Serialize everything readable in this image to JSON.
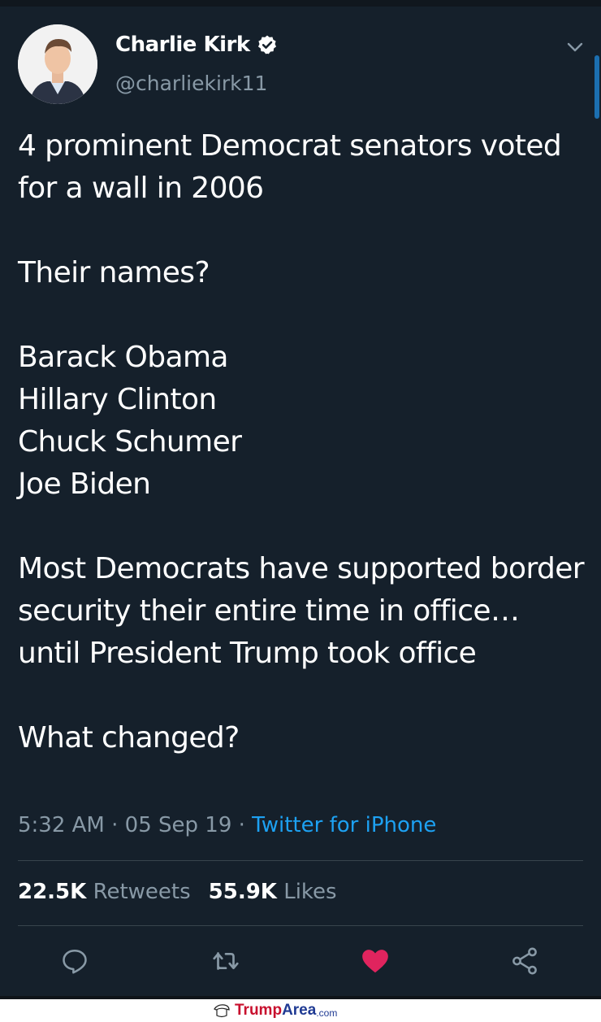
{
  "user": {
    "name": "Charlie Kirk",
    "handle": "@charliekirk11",
    "verified": true
  },
  "tweet": {
    "text": "4 prominent Democrat senators voted for a wall in 2006\n\nTheir names?\n\nBarack Obama\nHillary Clinton\nChuck Schumer\nJoe Biden\n\nMost Democrats have supported border security their entire time in office… until President Trump took office\n\nWhat changed?",
    "time": "5:32 AM",
    "date": "05 Sep 19",
    "separator": "·",
    "source": "Twitter for iPhone"
  },
  "stats": {
    "retweets_count": "22.5K",
    "retweets_label": "Retweets",
    "likes_count": "55.9K",
    "likes_label": "Likes"
  },
  "actions": {
    "reply_icon": "reply-icon",
    "retweet_icon": "retweet-icon",
    "like_icon": "heart-icon",
    "share_icon": "share-icon",
    "liked": true
  },
  "colors": {
    "background": "#15202b",
    "link": "#1da1f2",
    "muted": "#8899a6",
    "like": "#e0245e"
  },
  "watermark": {
    "brand_part1": "Trump",
    "brand_part2": "Area",
    "brand_suffix": ".com"
  }
}
